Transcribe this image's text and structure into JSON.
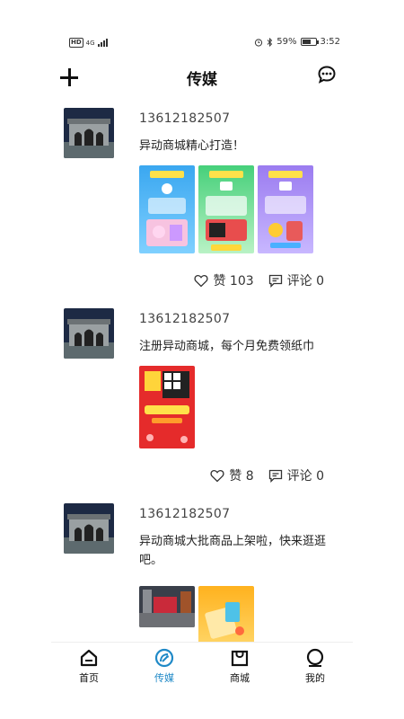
{
  "status_bar": {
    "network": "4G",
    "hd": "HD",
    "battery_percent": "59%",
    "battery_level": 0.59,
    "time": "3:52"
  },
  "top_bar": {
    "title": "传媒",
    "add_icon": "plus-icon",
    "message_icon": "chat-bubble-icon"
  },
  "posts": [
    {
      "user": "13612182507",
      "text": "异动商城精心打造！",
      "image_count": 3,
      "like_label": "赞 103",
      "comment_label": "评论 0"
    },
    {
      "user": "13612182507",
      "text": "注册异动商城，每个月免费领纸巾",
      "image_count": 1,
      "like_label": "赞 8",
      "comment_label": "评论 0"
    },
    {
      "user": "13612182507",
      "text": "异动商城大批商品上架啦，快来逛逛吧。",
      "image_count": 2
    }
  ],
  "bottom_nav": [
    {
      "label": "首页",
      "icon": "home-icon",
      "active": false
    },
    {
      "label": "传媒",
      "icon": "media-icon",
      "active": true
    },
    {
      "label": "商城",
      "icon": "shopping-bag-icon",
      "active": false
    },
    {
      "label": "我的",
      "icon": "profile-circle-icon",
      "active": false
    }
  ],
  "colors": {
    "accent": "#1f89c7",
    "text": "#222222",
    "nav_border": "#eeeeee"
  }
}
